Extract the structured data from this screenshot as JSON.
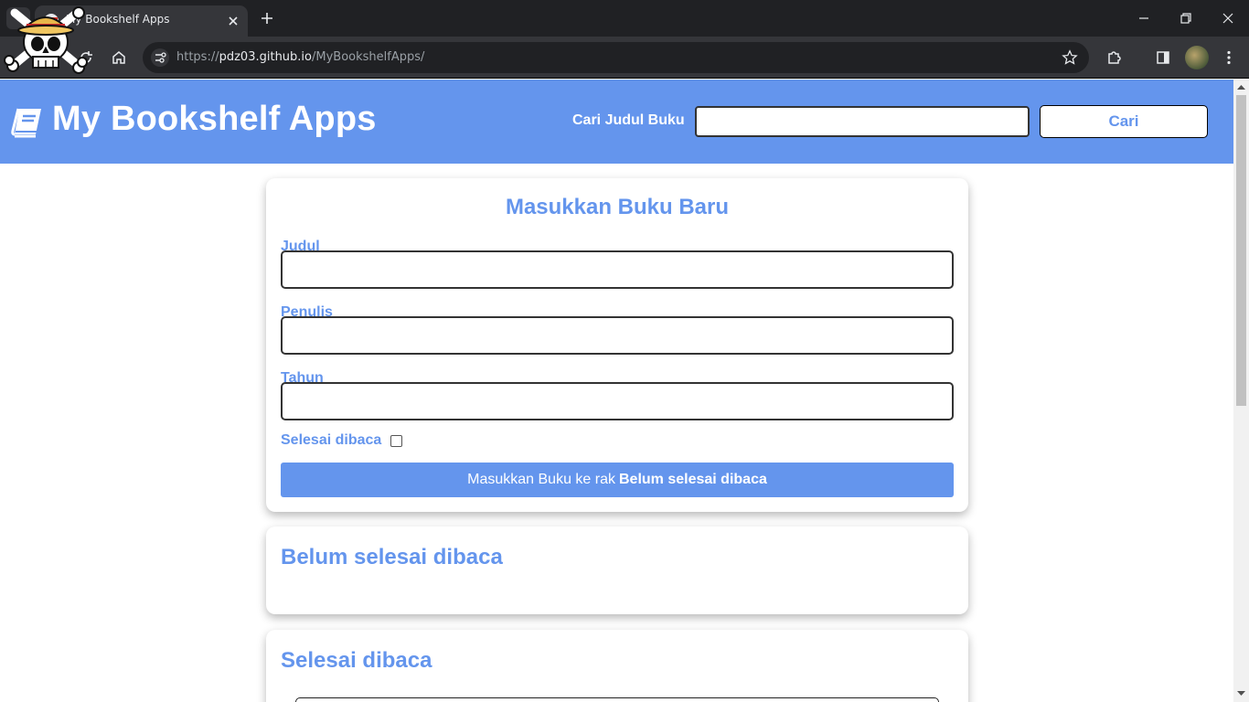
{
  "browser": {
    "tab_title": "My Bookshelf Apps",
    "url_prefix": "https://",
    "url_host": "pdz03.github.io",
    "url_path": "/MyBookshelfApps/"
  },
  "header": {
    "title": "My Bookshelf Apps",
    "search_label": "Cari Judul Buku",
    "search_value": "",
    "search_button": "Cari",
    "background": "#6495ed"
  },
  "input_form": {
    "title": "Masukkan Buku Baru",
    "title_label": "Judul",
    "author_label": "Penulis",
    "year_label": "Tahun",
    "title_value": "",
    "author_value": "",
    "year_value": "",
    "complete_label": "Selesai dibaca",
    "complete_checked": false,
    "submit_prefix": "Masukkan Buku ke rak",
    "submit_shelf": "Belum selesai dibaca"
  },
  "shelves": {
    "incomplete_title": "Belum selesai dibaca",
    "complete_title": "Selesai dibaca"
  },
  "colors": {
    "accent": "#6495ed",
    "chrome_dark": "#202124",
    "chrome_mid": "#35363a"
  }
}
